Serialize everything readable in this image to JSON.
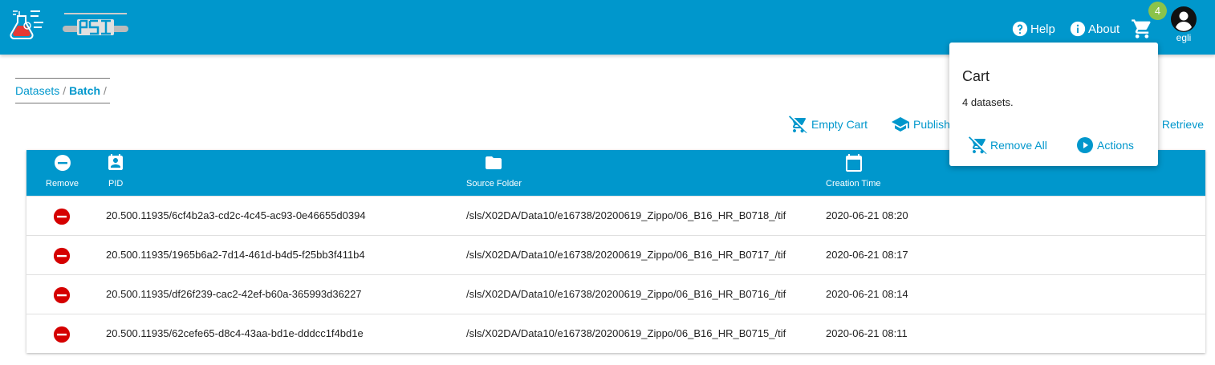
{
  "header": {
    "help_label": "Help",
    "about_label": "About",
    "cart_count": "4",
    "username": "egli"
  },
  "breadcrumb": {
    "items": [
      "Datasets",
      "Batch"
    ]
  },
  "actions": {
    "empty_cart": "Empty Cart",
    "publish": "Publish",
    "retrieve": "Retrieve"
  },
  "table": {
    "columns": [
      "Remove",
      "PID",
      "Source Folder",
      "Creation Time"
    ],
    "rows": [
      {
        "pid": "20.500.11935/6cf4b2a3-cd2c-4c45-ac93-0e46655d0394",
        "source_folder": "/sls/X02DA/Data10/e16738/20200619_Zippo/06_B16_HR_B0718_/tif",
        "creation_time": "2020-06-21 08:20"
      },
      {
        "pid": "20.500.11935/1965b6a2-7d14-461d-b4d5-f25bb3f411b4",
        "source_folder": "/sls/X02DA/Data10/e16738/20200619_Zippo/06_B16_HR_B0717_/tif",
        "creation_time": "2020-06-21 08:17"
      },
      {
        "pid": "20.500.11935/df26f239-cac2-42ef-b60a-365993d36227",
        "source_folder": "/sls/X02DA/Data10/e16738/20200619_Zippo/06_B16_HR_B0716_/tif",
        "creation_time": "2020-06-21 08:14"
      },
      {
        "pid": "20.500.11935/62cefe65-d8c4-43aa-bd1e-dddcc1f4bd1e",
        "source_folder": "/sls/X02DA/Data10/e16738/20200619_Zippo/06_B16_HR_B0715_/tif",
        "creation_time": "2020-06-21 08:11"
      }
    ]
  },
  "cart_popup": {
    "title": "Cart",
    "count_text": "4 datasets.",
    "remove_all": "Remove All",
    "actions": "Actions"
  },
  "colors": {
    "primary": "#0097cc",
    "badge": "#8bc34a",
    "remove": "#d50000"
  },
  "icons": [
    "scicat-logo",
    "psi-logo",
    "help-icon",
    "info-icon",
    "cart-icon",
    "account-icon",
    "remove-shopping-cart-icon",
    "school-icon",
    "minus-circle-icon",
    "badge-icon",
    "folder-icon",
    "calendar-icon",
    "play-circle-icon"
  ]
}
